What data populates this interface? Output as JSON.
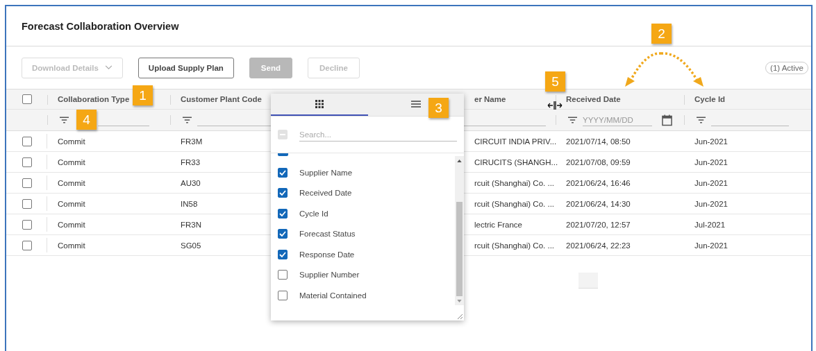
{
  "page": {
    "title": "Forecast Collaboration Overview"
  },
  "toolbar": {
    "buttons": [
      {
        "label": "Download Details",
        "kind": "dropdown",
        "disabled": true
      },
      {
        "label": "Upload Supply Plan",
        "kind": "outline",
        "disabled": false
      },
      {
        "label": "Send",
        "kind": "filled",
        "disabled": true
      },
      {
        "label": "Decline",
        "kind": "outline",
        "disabled": true
      }
    ],
    "filter_chip": "(1) Active"
  },
  "table": {
    "header_checkbox": {
      "checked": false
    },
    "columns": [
      {
        "label": "Collaboration Type",
        "kind": "text"
      },
      {
        "label": "Customer Plant Code",
        "kind": "text"
      },
      {
        "label": "er Name",
        "kind": "text"
      },
      {
        "label": "Received Date",
        "kind": "date",
        "placeholder": "YYYY/MM/DD"
      },
      {
        "label": "Cycle Id",
        "kind": "text"
      }
    ],
    "rows": [
      {
        "selected": false,
        "cells": [
          "Commit",
          "FR3M",
          "CIRCUIT INDIA PRIV...",
          "2021/07/14, 08:50",
          "Jun-2021"
        ]
      },
      {
        "selected": false,
        "cells": [
          "Commit",
          "FR33",
          "CIRUCITS (SHANGH...",
          "2021/07/08, 09:59",
          "Jun-2021"
        ]
      },
      {
        "selected": false,
        "cells": [
          "Commit",
          "AU30",
          "rcuit (Shanghai) Co. ...",
          "2021/06/24, 16:46",
          "Jun-2021"
        ]
      },
      {
        "selected": false,
        "cells": [
          "Commit",
          "IN58",
          "rcuit (Shanghai) Co. ...",
          "2021/06/24, 14:30",
          "Jun-2021"
        ]
      },
      {
        "selected": false,
        "cells": [
          "Commit",
          "FR3N",
          "lectric France",
          "2021/07/20, 12:57",
          "Jul-2021"
        ]
      },
      {
        "selected": false,
        "cells": [
          "Commit",
          "SG05",
          "rcuit (Shanghai) Co. ...",
          "2021/06/24, 22:23",
          "Jun-2021"
        ]
      }
    ]
  },
  "column_menu": {
    "tabs": [
      {
        "kind": "grid",
        "selected": true
      },
      {
        "kind": "menu",
        "selected": false
      }
    ],
    "search_placeholder": "Search...",
    "select_all": {
      "indeterminate": true
    },
    "items": [
      {
        "checked": true
      },
      {
        "label": "Supplier Name",
        "checked": true
      },
      {
        "label": "Received Date",
        "checked": true
      },
      {
        "label": "Cycle Id",
        "checked": true
      },
      {
        "label": "Forecast Status",
        "checked": true
      },
      {
        "label": "Response Date",
        "checked": true
      },
      {
        "label": "Supplier Number",
        "checked": false
      },
      {
        "label": "Material Contained",
        "checked": false
      }
    ]
  },
  "callouts": [
    "1",
    "2",
    "3",
    "4",
    "5"
  ]
}
